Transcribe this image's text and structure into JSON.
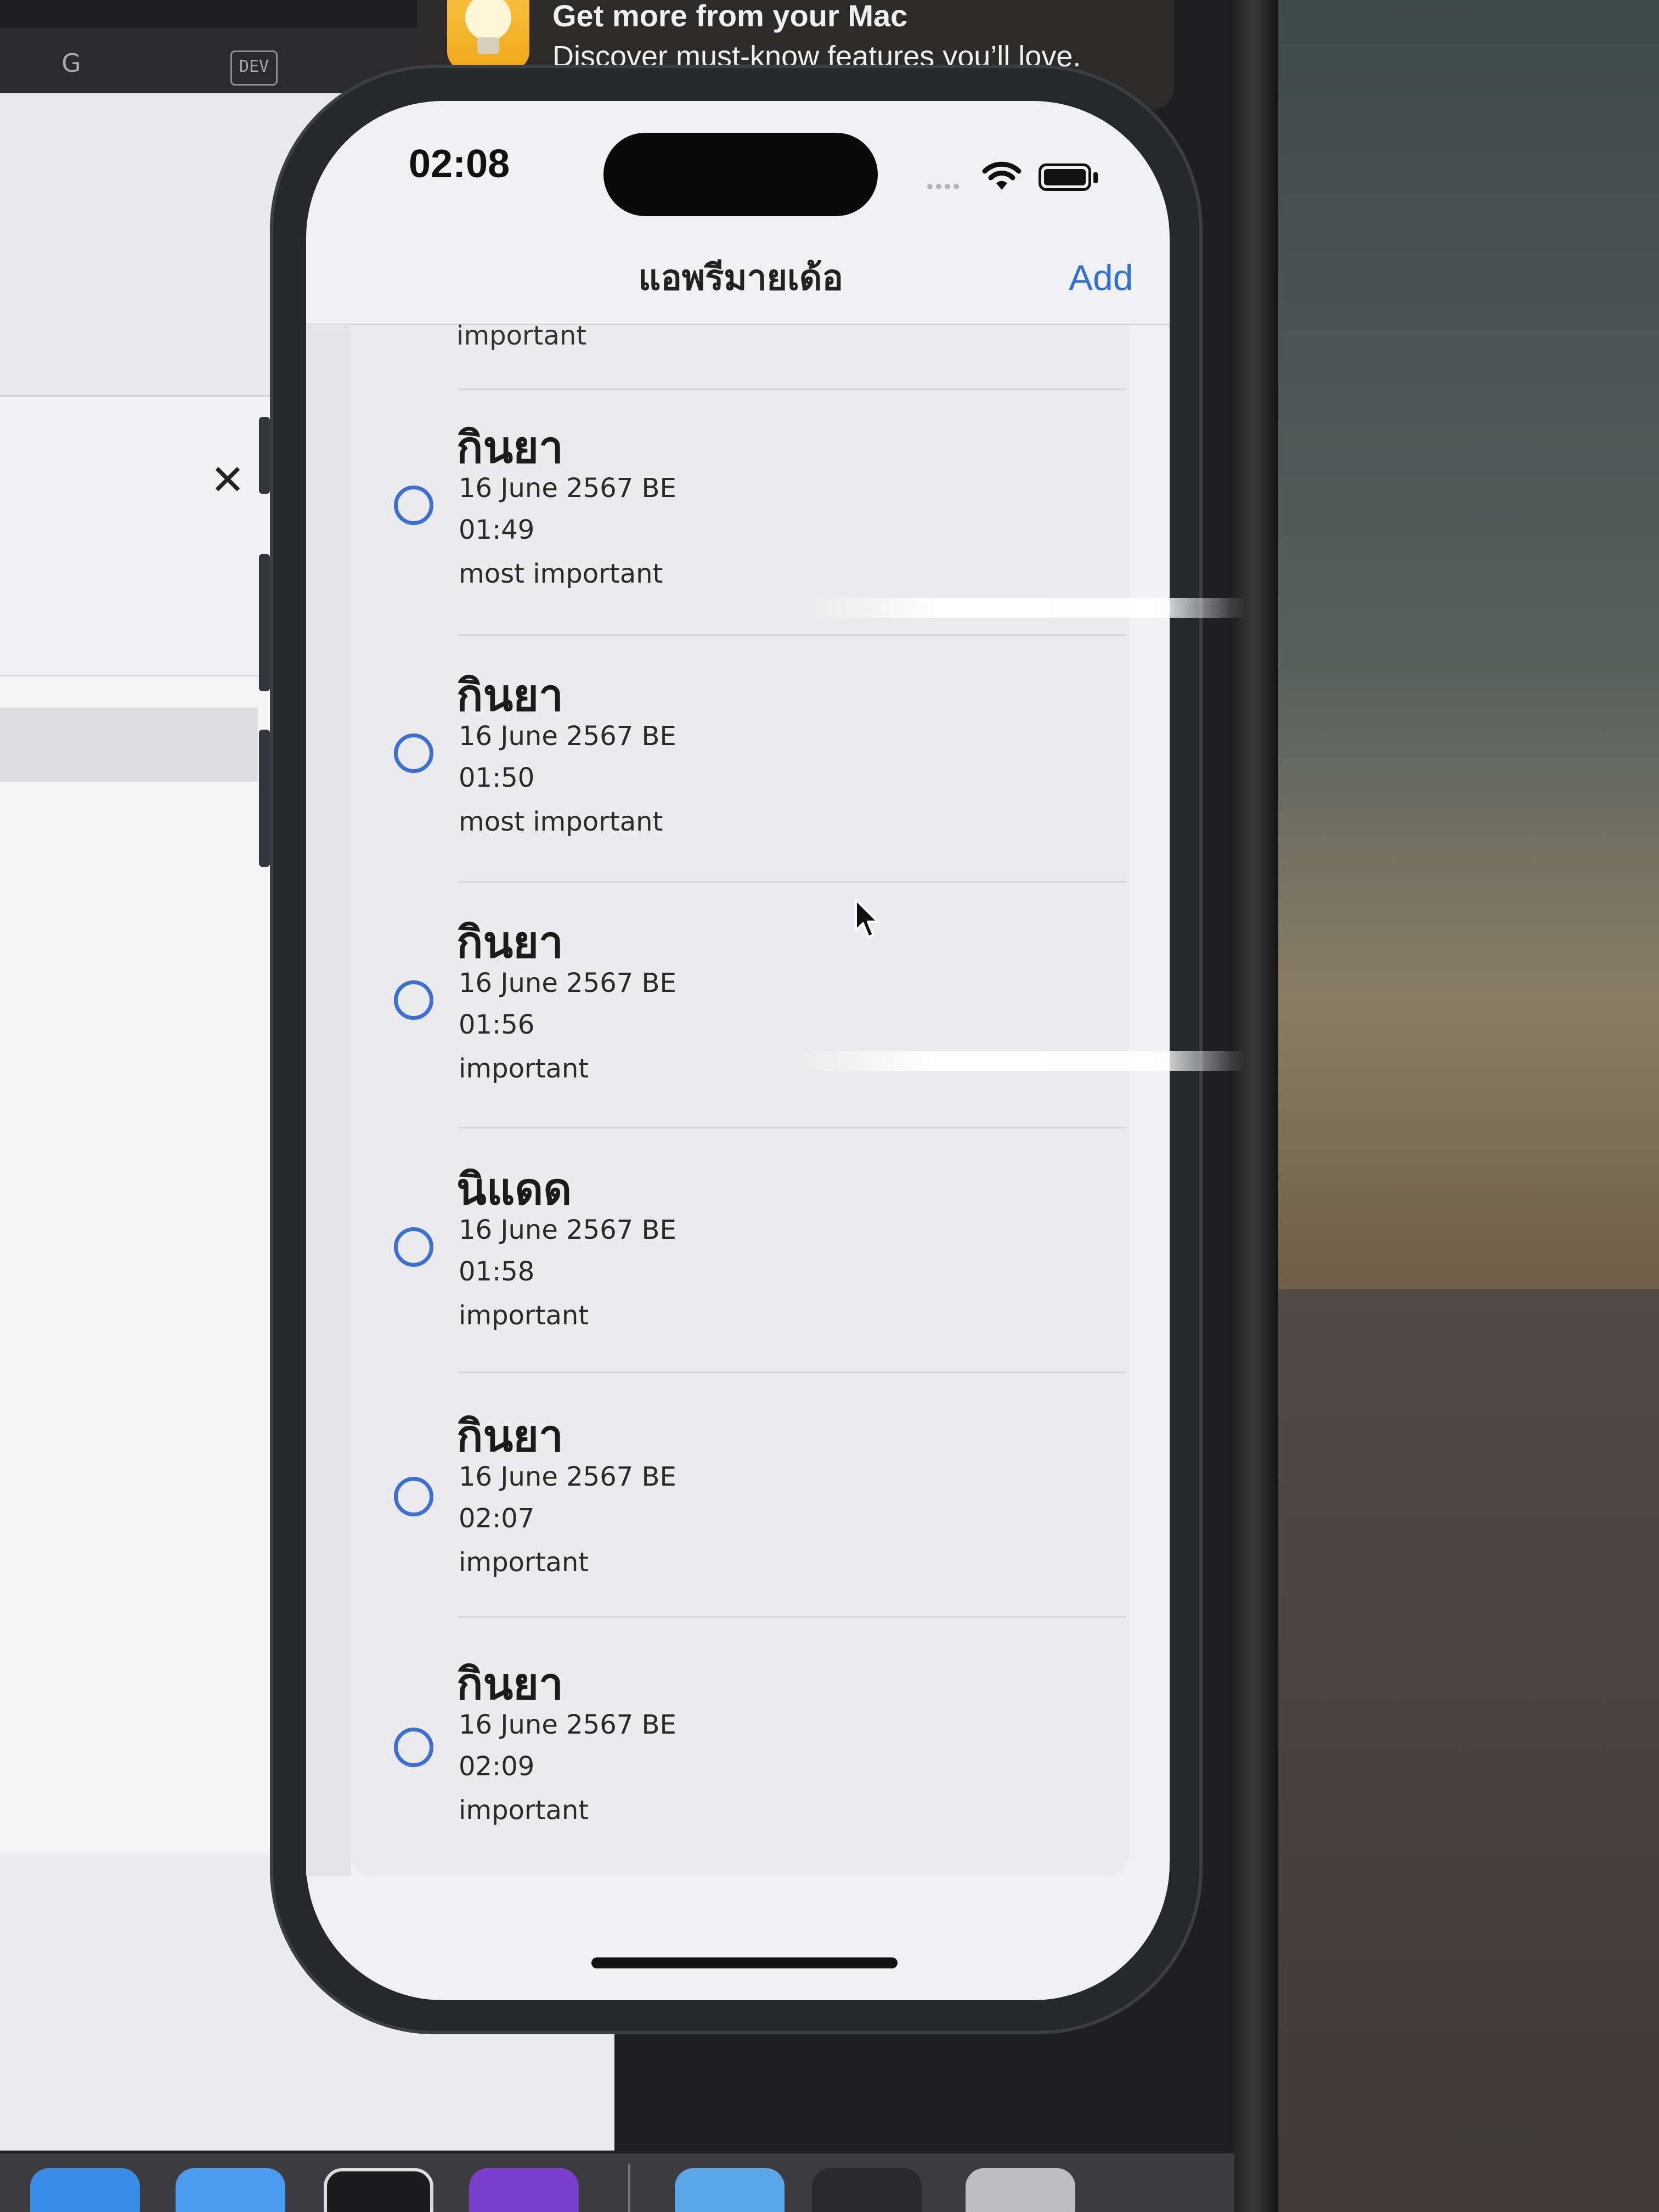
{
  "notification": {
    "title": "Get more from your Mac",
    "body": "Discover must-know features you’ll love."
  },
  "mac_toolbar": {
    "icon_1": "G",
    "dev_badge": "DEV"
  },
  "status_bar": {
    "time": "02:08"
  },
  "nav": {
    "title": "แอพรีมายเด้อ",
    "add_label": "Add"
  },
  "list": {
    "partial_top_priority": "important",
    "items": [
      {
        "title": "กินยา",
        "date": "16 June 2567 BE",
        "time": "01:49",
        "priority": "most important"
      },
      {
        "title": "กินยา",
        "date": "16 June 2567 BE",
        "time": "01:50",
        "priority": "most important"
      },
      {
        "title": "กินยา",
        "date": "16 June 2567 BE",
        "time": "01:56",
        "priority": "important"
      },
      {
        "title": "นิแดด",
        "date": "16 June 2567 BE",
        "time": "01:58",
        "priority": "important"
      },
      {
        "title": "กินยา",
        "date": "16 June 2567 BE",
        "time": "02:07",
        "priority": "important"
      },
      {
        "title": "กินยา",
        "date": "16 June 2567 BE",
        "time": "02:09",
        "priority": "important"
      }
    ]
  },
  "colors": {
    "accent": "#2f6fd8",
    "circle": "#3a6fd6"
  }
}
